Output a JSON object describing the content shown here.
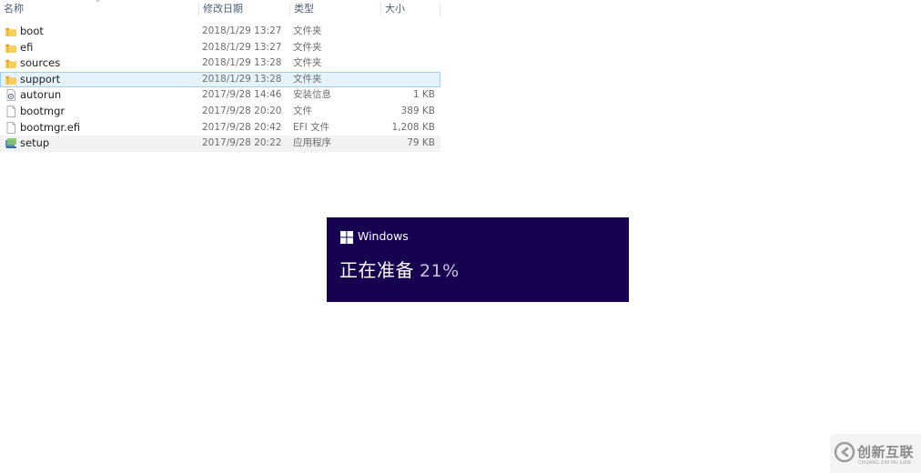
{
  "explorer": {
    "columns": {
      "name": "名称",
      "date": "修改日期",
      "type": "类型",
      "size": "大小"
    },
    "files": [
      {
        "name": "boot",
        "date": "2018/1/29 13:27",
        "type": "文件夹",
        "size": "",
        "icon": "folder-icon"
      },
      {
        "name": "efi",
        "date": "2018/1/29 13:27",
        "type": "文件夹",
        "size": "",
        "icon": "folder-icon"
      },
      {
        "name": "sources",
        "date": "2018/1/29 13:28",
        "type": "文件夹",
        "size": "",
        "icon": "folder-icon"
      },
      {
        "name": "support",
        "date": "2018/1/29 13:28",
        "type": "文件夹",
        "size": "",
        "icon": "folder-icon",
        "selected": true
      },
      {
        "name": "autorun",
        "date": "2017/9/28 14:46",
        "type": "安装信息",
        "size": "1 KB",
        "icon": "setup-info-icon"
      },
      {
        "name": "bootmgr",
        "date": "2017/9/28 20:20",
        "type": "文件",
        "size": "389 KB",
        "icon": "file-icon"
      },
      {
        "name": "bootmgr.efi",
        "date": "2017/9/28 20:42",
        "type": "EFI 文件",
        "size": "1,208 KB",
        "icon": "file-icon"
      },
      {
        "name": "setup",
        "date": "2017/9/28 20:22",
        "type": "应用程序",
        "size": "79 KB",
        "icon": "setup-app-icon"
      }
    ]
  },
  "setup_dialog": {
    "brand": "Windows",
    "status": "正在准备",
    "progress_text": "21%",
    "progress": 0.21,
    "background_color": "#170050"
  },
  "watermark": {
    "text": "创新互联",
    "subtext": "CHUANG XIN HU LIAN"
  }
}
